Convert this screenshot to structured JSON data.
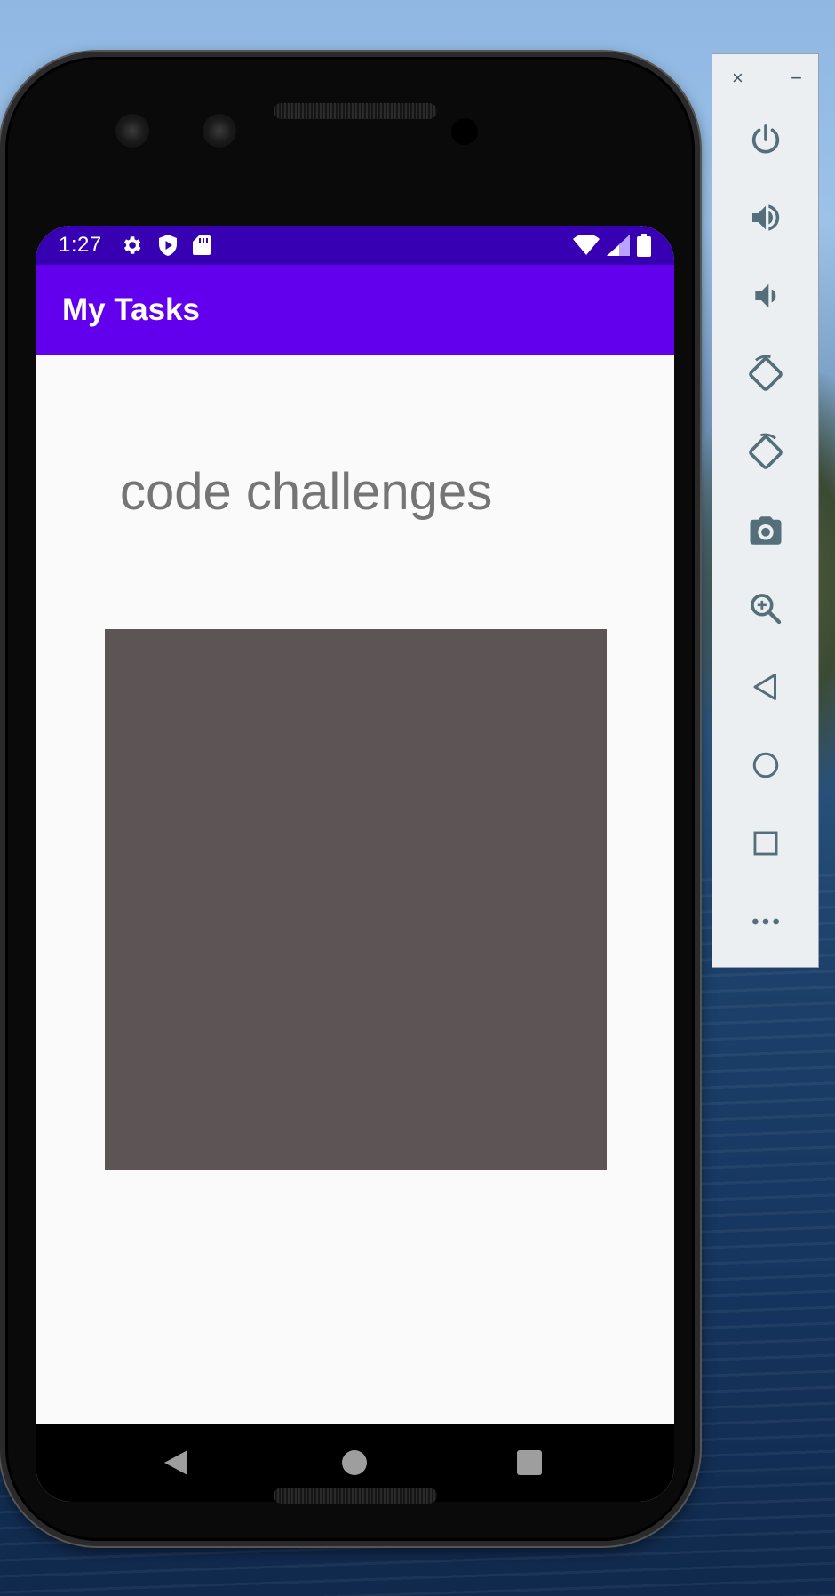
{
  "status_bar": {
    "time": "1:27",
    "left_icons": [
      "settings-icon",
      "shield-play-icon",
      "sd-card-icon"
    ],
    "right_icons": [
      "wifi-icon",
      "signal-icon",
      "battery-icon"
    ],
    "background": "#3700b3"
  },
  "app_bar": {
    "title": "My Tasks",
    "background": "#6200ee"
  },
  "task": {
    "title": "code challenges",
    "image_color": "#5d5555"
  },
  "nav_bar": {
    "buttons": [
      "back-triangle-icon",
      "home-circle-icon",
      "recents-square-icon"
    ]
  },
  "emulator_panel": {
    "top_controls": [
      "×",
      "−"
    ],
    "buttons": [
      "power-icon",
      "volume-up-icon",
      "volume-down-icon",
      "rotate-left-icon",
      "rotate-right-icon",
      "camera-icon",
      "zoom-icon",
      "back-icon",
      "home-icon",
      "overview-icon",
      "more-icon"
    ]
  }
}
